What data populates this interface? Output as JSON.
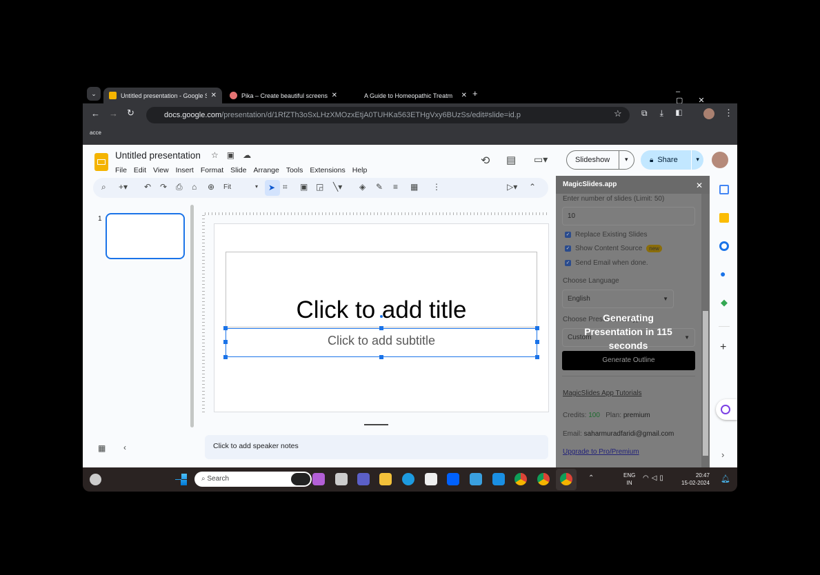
{
  "browser": {
    "tabs": [
      {
        "title": "Untitled presentation - Google S"
      },
      {
        "title": "Pika – Create beautiful screensh"
      },
      {
        "title": "A Guide to Homeopathic Treatm"
      }
    ],
    "url_domain": "docs.google.com",
    "url_path": "/presentation/d/1RfZTh3oSxLHzXMOzxEtjA0TUHKa563ETHgVxy6BUzSs/edit#slide=id.p",
    "bookmark": "acce"
  },
  "doc": {
    "title": "Untitled presentation",
    "menu": [
      "File",
      "Edit",
      "View",
      "Insert",
      "Format",
      "Slide",
      "Arrange",
      "Tools",
      "Extensions",
      "Help"
    ],
    "slideshow": "Slideshow",
    "share": "Share",
    "zoom": "Fit"
  },
  "filmstrip": {
    "slide_number": "1"
  },
  "slide": {
    "title_placeholder": "Click to add title",
    "subtitle_placeholder": "Click to add subtitle"
  },
  "notes": {
    "placeholder": "Click to add speaker notes"
  },
  "panel": {
    "title": "MagicSlides.app",
    "slides_label": "Enter number of slides (Limit: 50)",
    "slides_value": "10",
    "options": [
      "Replace Existing Slides",
      "Show Content Source",
      "Send Email when done."
    ],
    "new_badge": "new",
    "language_label": "Choose Language",
    "language": "English",
    "type_label": "Choose Presentation Type",
    "type": "Custom",
    "generate": "Generate Outline",
    "overlay": "Generating Presentation in 115 seconds",
    "tutorials": "MagicSlides App Tutorials",
    "credits_label": "Credits:",
    "credits": "100",
    "plan_label": "Plan:",
    "plan": "premium",
    "email_label": "Email:",
    "email": "saharmuradfaridi@gmail.com",
    "upgrade": "Upgrade to Pro/Premium",
    "credits_color": "#1e7e34"
  },
  "taskbar": {
    "search": "Search",
    "lang1": "ENG",
    "lang2": "IN",
    "time": "20:47",
    "date": "15-02-2024"
  }
}
